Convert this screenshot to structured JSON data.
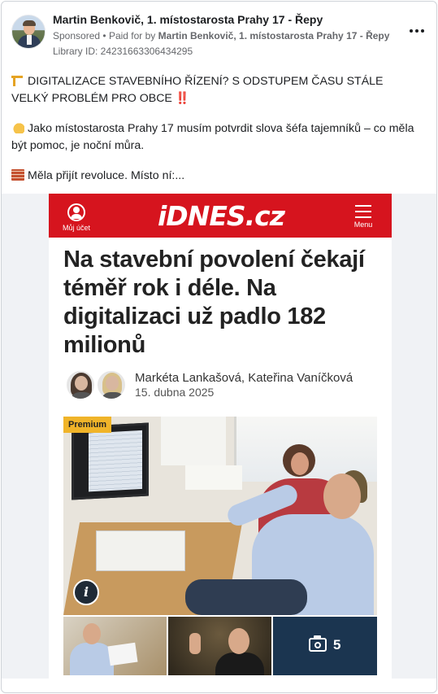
{
  "post": {
    "page_name": "Martin Benkovič, 1. místostarosta Prahy 17 - Řepy",
    "sponsored": "Sponsored",
    "paid_for_prefix": "Paid for by",
    "payer": "Martin Benkovič, 1. místostarosta Prahy 17 - Řepy",
    "library_id": "Library ID: 24231663306434295",
    "paragraphs": [
      {
        "icon": "construction-crane-icon",
        "text": "DIGITALIZACE STAVEBNÍHO ŘÍZENÍ? S ODSTUPEM ČASU STÁLE VELKÝ PROBLÉM PRO OBCE",
        "suffix": "‼️"
      },
      {
        "icon": "writing-hand-icon",
        "text": "Jako místostarosta Prahy 17 musím potvrdit slova šéfa tajemníků – co měla být pomoc, je noční můra."
      },
      {
        "icon": "brick-icon",
        "text": "Měla přijít revoluce. Místo ní:..."
      }
    ]
  },
  "article": {
    "account_label": "Můj účet",
    "logo": "iDNES.cz",
    "menu_label": "Menu",
    "headline": "Na stavební povolení čekají téměř rok i déle. Na digitalizaci už padlo 182 milionů",
    "authors": "Markéta Lankašová, Kateřina Vaníčková",
    "date": "15. dubna 2025",
    "badge": "Premium",
    "gallery_count": "5"
  },
  "colors": {
    "idnes_red": "#d6141e",
    "premium_badge": "#f0b429",
    "gallery_tile": "#1b3550"
  }
}
